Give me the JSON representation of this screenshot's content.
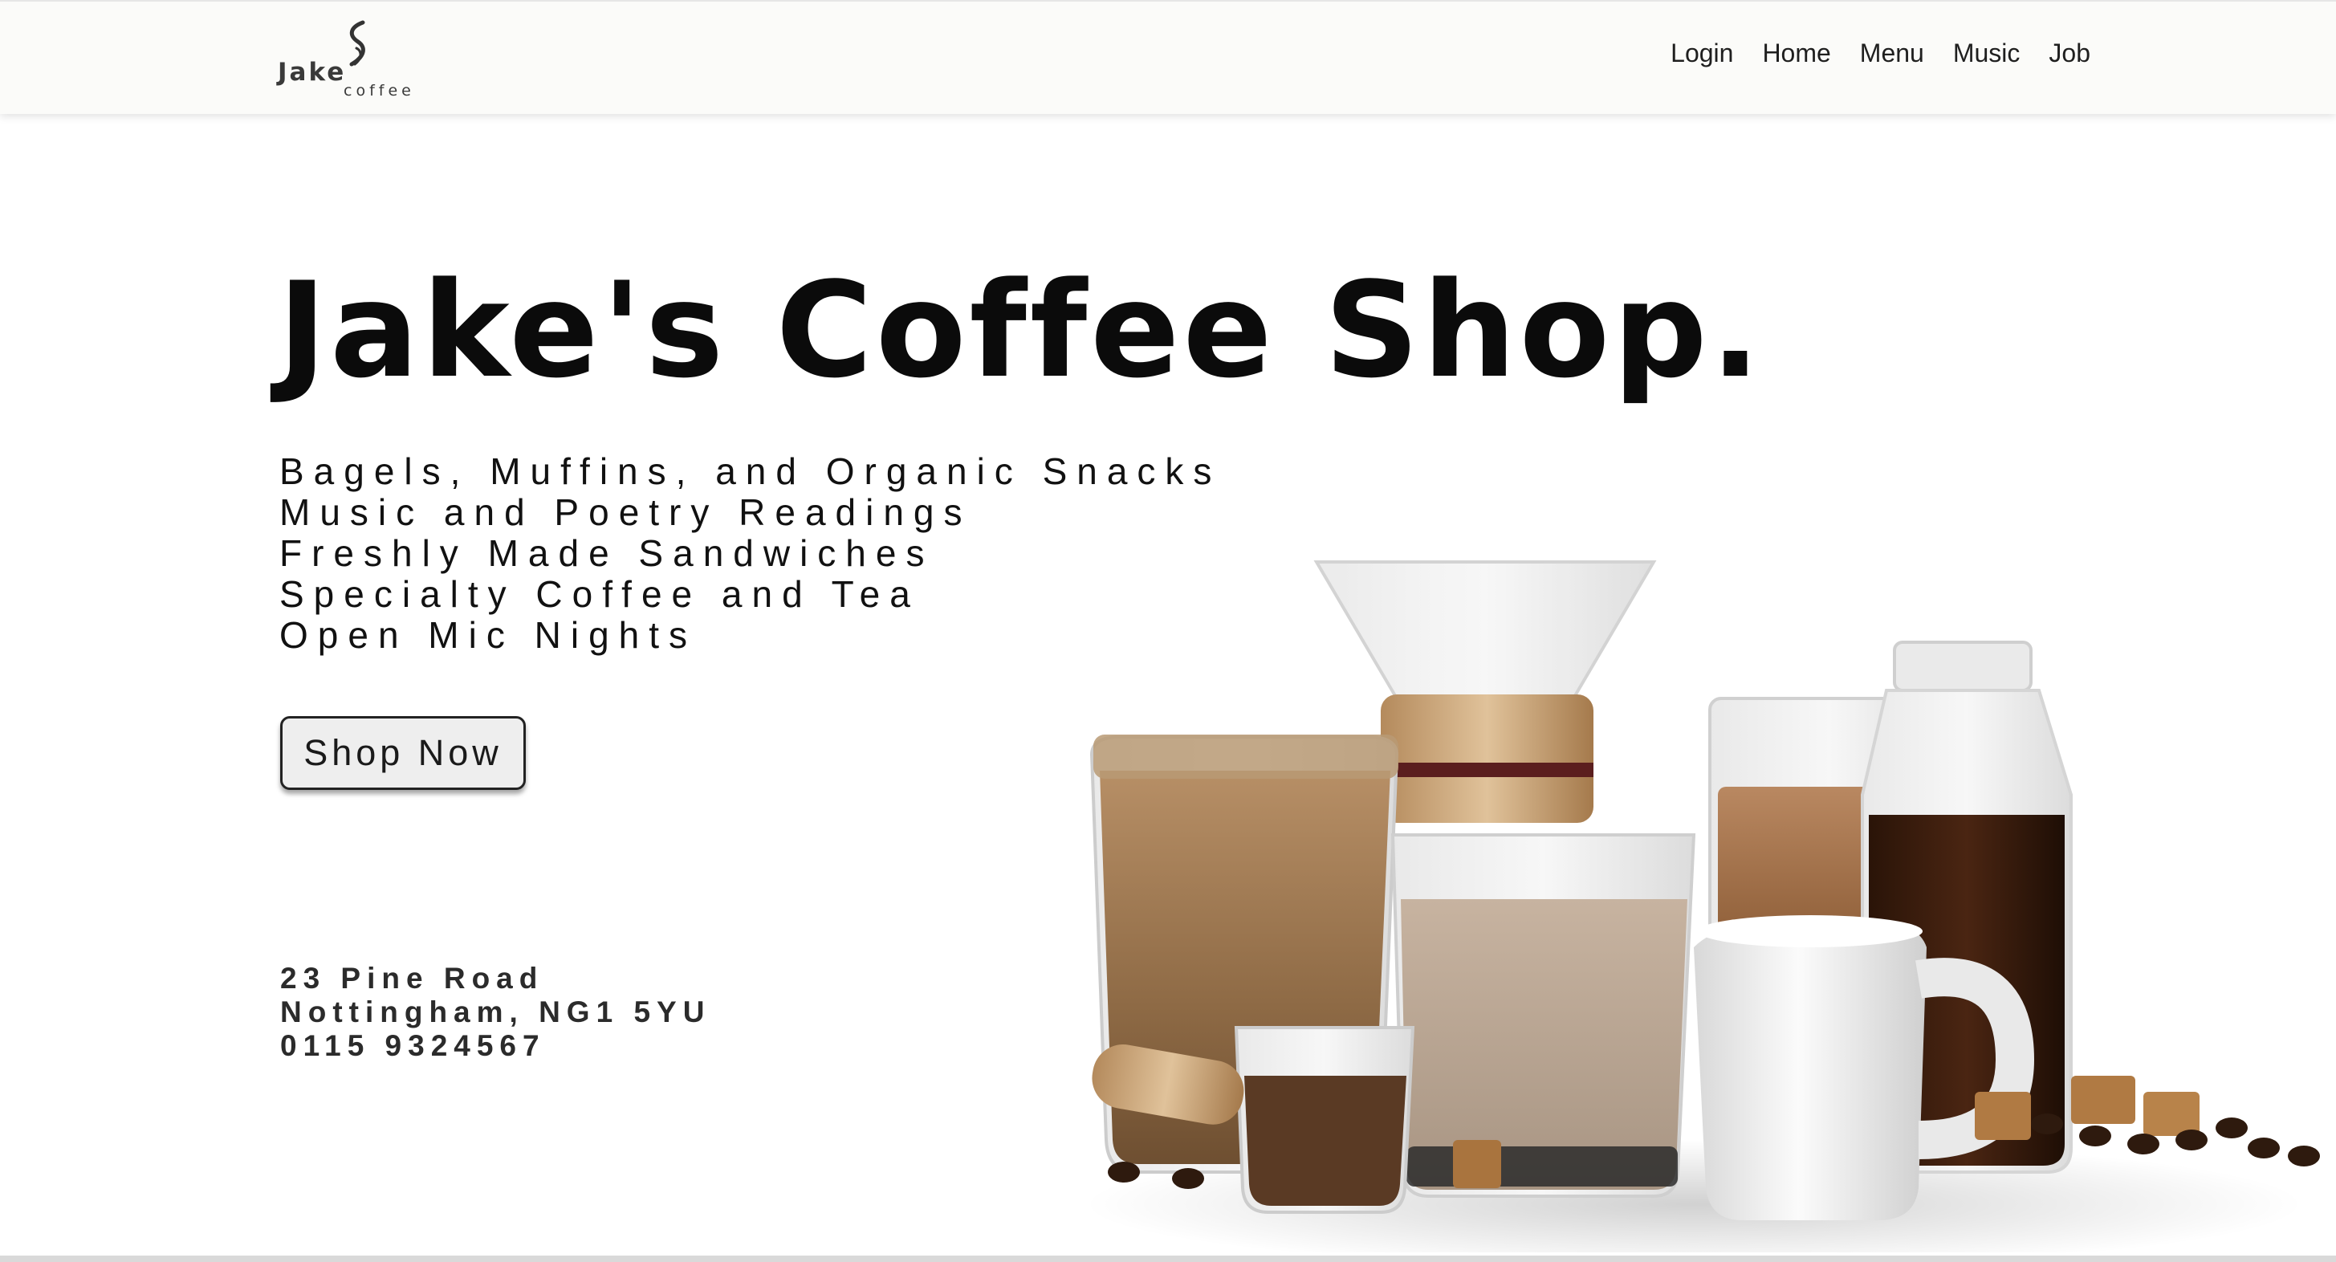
{
  "header": {
    "logo": {
      "word": "Jake",
      "sub": "coffee"
    },
    "nav": [
      "Login",
      "Home",
      "Menu",
      "Music",
      "Job"
    ]
  },
  "hero": {
    "title": "Jake's Coffee Shop.",
    "features": [
      "Bagels, Muffins, and Organic Snacks",
      "Music and Poetry Readings",
      "Freshly Made Sandwiches",
      "Specialty Coffee and Tea",
      "Open Mic Nights"
    ],
    "cta_label": "Shop Now"
  },
  "address": {
    "line1": "23 Pine Road",
    "line2": "Nottingham, NG1 5YU",
    "phone": "0115 9324567"
  },
  "colors": {
    "header_bg": "#fbfbf9",
    "text": "#0b0b0b",
    "button_bg": "#eeeeee"
  }
}
